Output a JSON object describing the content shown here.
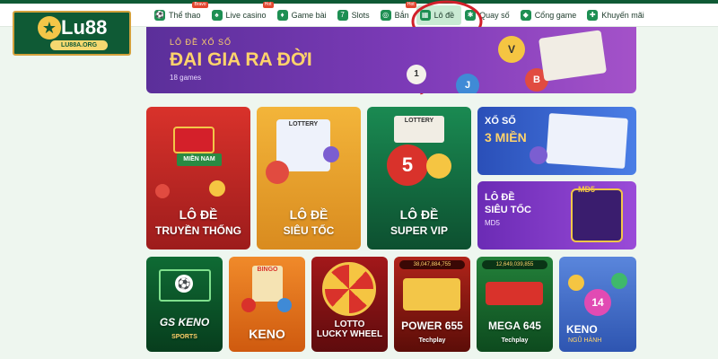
{
  "logo": {
    "text": "Lu88",
    "url": "LU88A.ORG"
  },
  "nav": [
    {
      "label": "Thể thao",
      "badge": "Bravo"
    },
    {
      "label": "Live casino",
      "badge": "Hot"
    },
    {
      "label": "Game bài",
      "badge": ""
    },
    {
      "label": "Slots",
      "badge": ""
    },
    {
      "label": "Bắn",
      "badge": "Hot"
    },
    {
      "label": "Lô đề",
      "badge": ""
    },
    {
      "label": "Quay số",
      "badge": ""
    },
    {
      "label": "Cổng game",
      "badge": ""
    },
    {
      "label": "Khuyến mãi",
      "badge": ""
    }
  ],
  "hero": {
    "small": "LÔ ĐỀ XỔ SỐ",
    "title": "ĐẠI GIA RA ĐỜI",
    "count": "18 games"
  },
  "big_cards": [
    {
      "line1": "LÔ ĐỀ",
      "line2": "TRUYỀN THỐNG",
      "tag": "MIỀN NAM",
      "color": "#c4282a"
    },
    {
      "line1": "LÔ ĐỀ",
      "line2": "SIÊU TỐC",
      "tag": "LOTTERY",
      "color": "#e9a02a"
    },
    {
      "line1": "LÔ ĐỀ",
      "line2": "SUPER VIP",
      "tag": "LOTTERY",
      "color": "#157042"
    }
  ],
  "side_cards": [
    {
      "line1": "XỔ SỐ",
      "line2": "3 MIỀN",
      "color": "#2d58c9"
    },
    {
      "line1": "LÔ ĐỀ",
      "line2": "SIÊU TỐC",
      "line3": "MD5",
      "badge": "MD5",
      "color": "#6b2bb5"
    }
  ],
  "small_cards": [
    {
      "title": "GS KENO",
      "sub": "SPORTS",
      "color": "#0f6b34"
    },
    {
      "title": "KENO",
      "sub": "BINGO",
      "color": "#e26d14"
    },
    {
      "title": "LOTTO\nLUCKY WHEEL",
      "sub": "LOTTO",
      "color": "#8c1113"
    },
    {
      "title": "POWER 655",
      "sub": "Techplay",
      "jackpot": "38,047,884,755",
      "color": "#9c1d12"
    },
    {
      "title": "MEGA 645",
      "sub": "Techplay",
      "jackpot": "12,649,039,855",
      "color": "#1a6b2f"
    },
    {
      "title": "KENO",
      "sub": "NGŨ HÀNH",
      "color": "#3d67c8"
    }
  ]
}
